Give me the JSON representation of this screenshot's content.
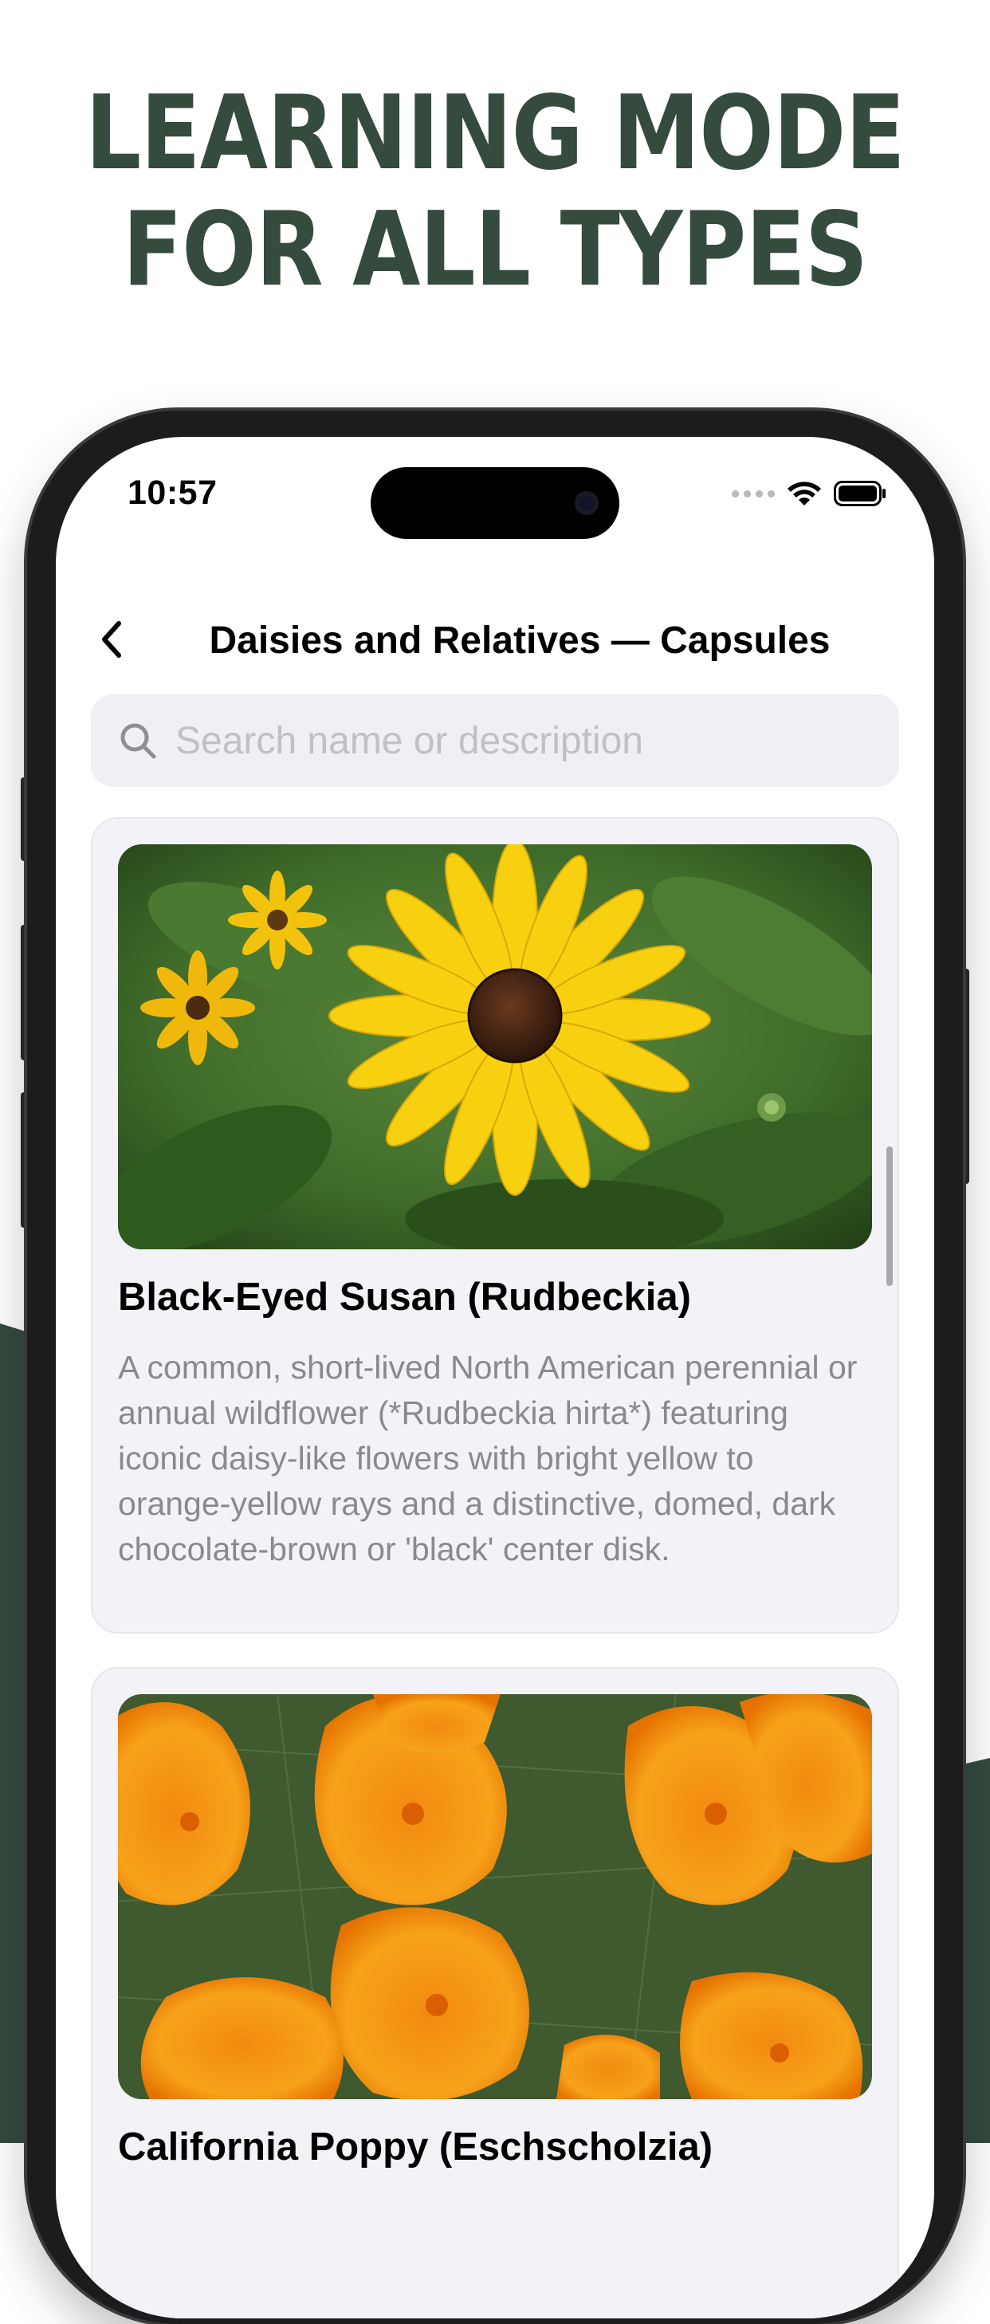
{
  "promo": {
    "title_line1": "LEARNING MODE",
    "title_line2": "FOR ALL TYPES",
    "accent_color": "#344b3e"
  },
  "status_bar": {
    "time": "10:57",
    "icons": [
      "signal-dots-icon",
      "wifi-icon",
      "battery-icon"
    ]
  },
  "nav": {
    "back_icon": "chevron-left-icon",
    "title": "Daisies and Relatives — Capsules"
  },
  "search": {
    "icon": "search-icon",
    "placeholder": "Search name or description",
    "value": ""
  },
  "cards": [
    {
      "image": "black-eyed-susan-photo",
      "title": "Black-Eyed Susan (Rudbeckia)",
      "description": "A common, short-lived North American perennial or annual wildflower (*Rudbeckia hirta*) featuring iconic daisy-like flowers with bright yellow to orange-yellow rays and a distinctive, domed, dark chocolate-brown or 'black' center disk."
    },
    {
      "image": "california-poppy-photo",
      "title": "California Poppy (Eschscholzia)",
      "description": ""
    }
  ]
}
